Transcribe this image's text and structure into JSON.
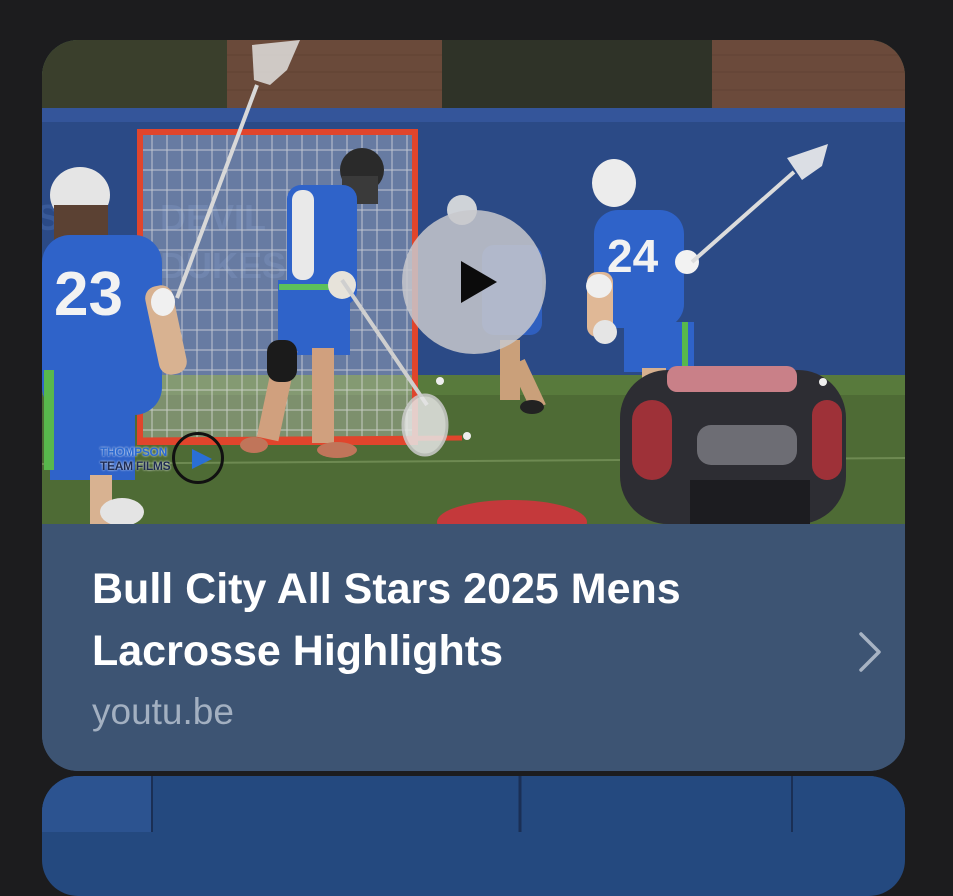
{
  "card": {
    "title": "Bull City All Stars 2025 Mens Lacrosse Highlights",
    "domain": "youtu.be",
    "chevron_icon": "chevron-right-icon",
    "play_icon": "play-icon"
  },
  "watermark": {
    "line1": "THOMPSON",
    "line2": "TEAM FILMS"
  },
  "players": {
    "left_number": "23",
    "right_number": "24"
  },
  "colors": {
    "background": "#1c1c1e",
    "card_info": "#3d5473",
    "title": "#ffffff",
    "domain": "#a3b0c1",
    "play_button": "#c8c8cd",
    "jersey_blue": "#2f63c9",
    "goal_frame": "#e0452c"
  }
}
